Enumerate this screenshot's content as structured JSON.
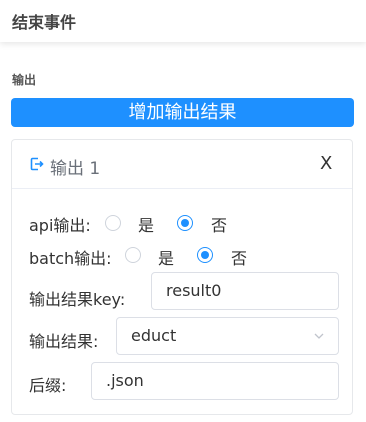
{
  "header": {
    "title": "结束事件"
  },
  "section": {
    "label": "输出"
  },
  "add_button": {
    "label": "增加输出结果"
  },
  "output_card": {
    "title": "输出 1",
    "icon": "output-arrow-icon",
    "close_glyph": "X",
    "api": {
      "label": "api输出:",
      "options": [
        "是",
        "否"
      ],
      "selected": "否"
    },
    "batch": {
      "label": "batch输出:",
      "options": [
        "是",
        "否"
      ],
      "selected": "否"
    },
    "result_key": {
      "label": "输出结果key:",
      "value": "result0"
    },
    "result": {
      "label": "输出结果:",
      "value": "educt"
    },
    "suffix": {
      "label": "后缀:",
      "value": ".json"
    }
  },
  "colors": {
    "accent": "#1e90ff",
    "header_text": "#444444",
    "card_title": "#6a7079",
    "border": "#dcdfe6"
  }
}
